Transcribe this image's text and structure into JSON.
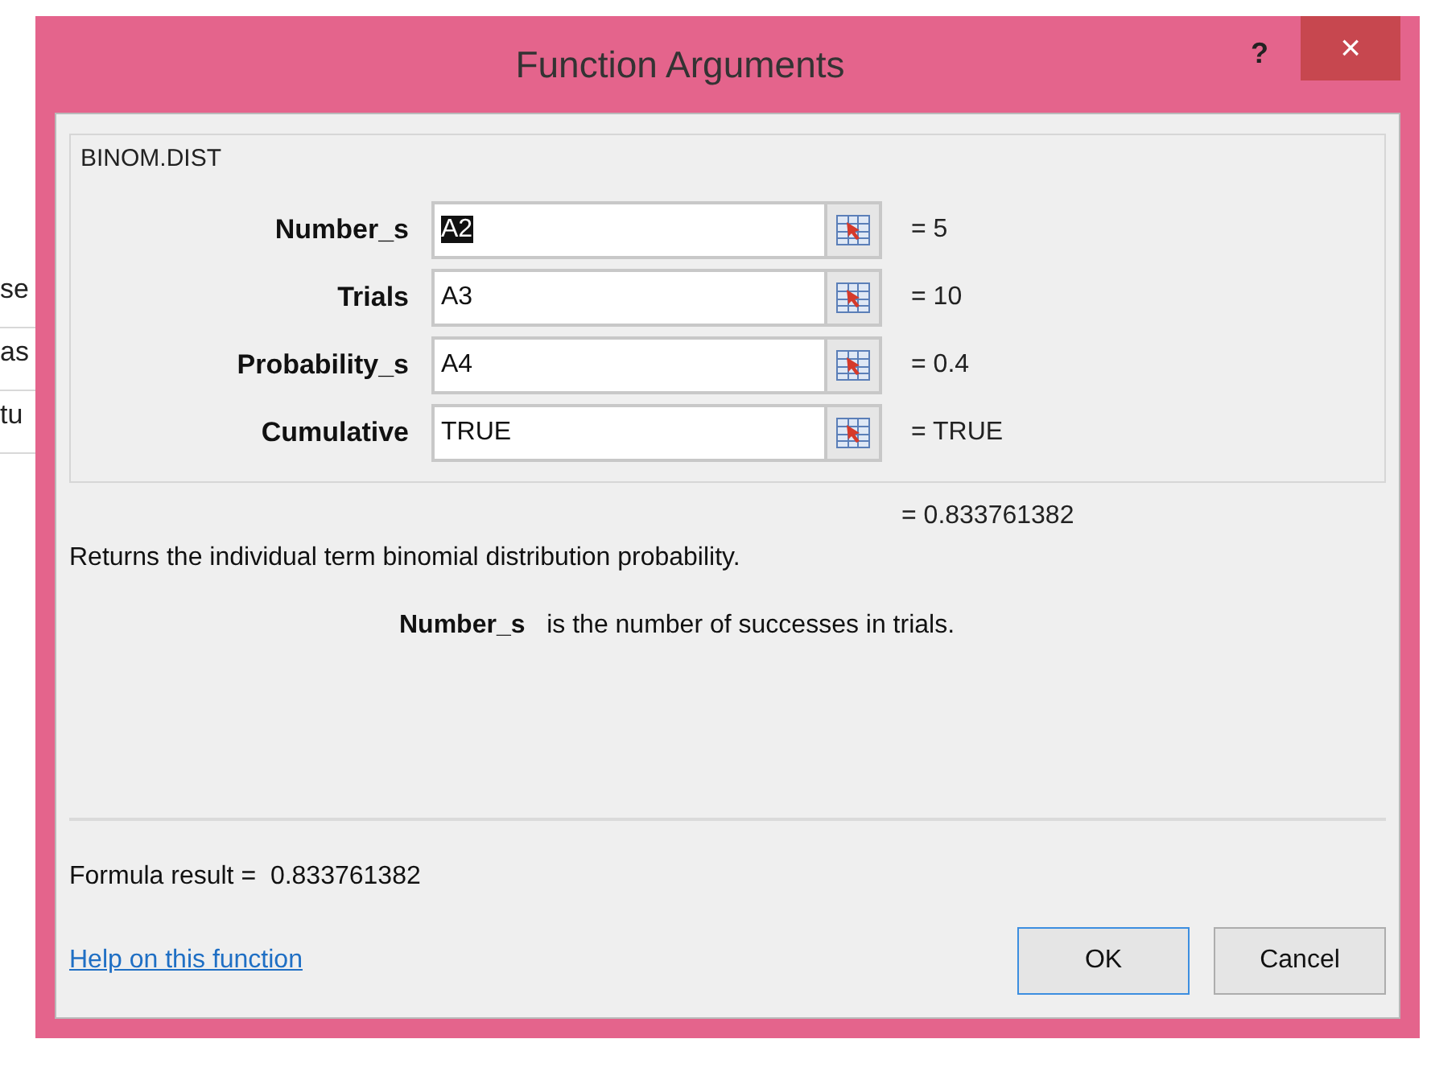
{
  "sheet": {
    "cells": [
      "se",
      "as",
      "tu"
    ]
  },
  "window": {
    "title": "Function Arguments",
    "help": "?",
    "close": "×"
  },
  "function_group": {
    "name": "BINOM.DIST",
    "arguments": [
      {
        "label": "Number_s",
        "value": "A2",
        "highlighted": true,
        "result": "= 5"
      },
      {
        "label": "Trials",
        "value": "A3",
        "highlighted": false,
        "result": "= 10"
      },
      {
        "label": "Probability_s",
        "value": "A4",
        "highlighted": false,
        "result": "= 0.4"
      },
      {
        "label": "Cumulative",
        "value": "TRUE",
        "highlighted": false,
        "result": "= TRUE"
      }
    ]
  },
  "overall_result": "= 0.833761382",
  "description": "Returns the individual term binomial distribution probability.",
  "argument_help": {
    "name": "Number_s",
    "text": "is the number of successes in trials."
  },
  "formula_result": {
    "label": "Formula result =",
    "value": "0.833761382"
  },
  "help_link": "Help on this function",
  "buttons": [
    {
      "label": "OK",
      "focused": true
    },
    {
      "label": "Cancel",
      "focused": false
    }
  ]
}
